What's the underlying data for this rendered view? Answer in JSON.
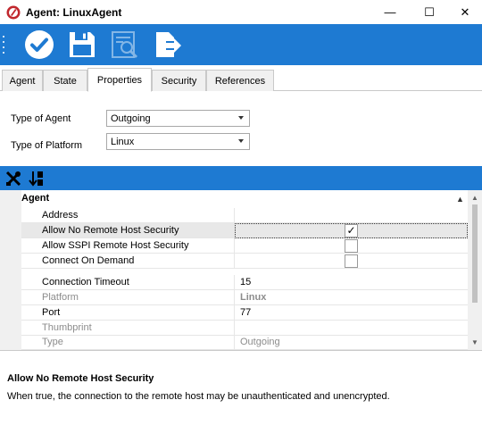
{
  "window": {
    "title": "Agent: LinuxAgent",
    "minimize": "—",
    "maximize": "☐",
    "close": "✕"
  },
  "toolbar": {
    "buttons": [
      {
        "name": "save-and-close",
        "icon": "check-circle-icon"
      },
      {
        "name": "save",
        "icon": "floppy-disk-icon"
      },
      {
        "name": "inspect",
        "icon": "magnify-document-icon",
        "disabled": true
      },
      {
        "name": "export",
        "icon": "export-document-icon"
      }
    ],
    "color": "#1e7ad2"
  },
  "tabs": [
    "Agent",
    "State",
    "Properties",
    "Security",
    "References"
  ],
  "active_tab": "Properties",
  "form": {
    "type_of_agent_label": "Type of Agent",
    "type_of_agent_value": "Outgoing",
    "type_of_platform_label": "Type of Platform",
    "type_of_platform_value": "Linux"
  },
  "grid": {
    "category": "Agent",
    "rows": [
      {
        "name": "Address",
        "value": ""
      },
      {
        "name": "Allow No Remote Host Security",
        "value": "",
        "checkbox": true,
        "checked": true,
        "selected": true
      },
      {
        "name": "Allow SSPI Remote Host Security",
        "value": "",
        "checkbox": true,
        "checked": false
      },
      {
        "name": "Connect On Demand",
        "value": "",
        "checkbox": true,
        "checked": false
      },
      {
        "name": "Connection Timeout",
        "value": "15"
      },
      {
        "name": "Platform",
        "value": "Linux",
        "readonly": true
      },
      {
        "name": "Port",
        "value": "77"
      },
      {
        "name": "Thumbprint",
        "value": "",
        "readonly": true
      },
      {
        "name": "Type",
        "value": "Outgoing",
        "readonly": true
      }
    ],
    "check_glyph": "✓"
  },
  "description": {
    "title": "Allow No Remote Host Security",
    "text": "When true, the connection to the remote host may be unauthenticated and unencrypted."
  }
}
